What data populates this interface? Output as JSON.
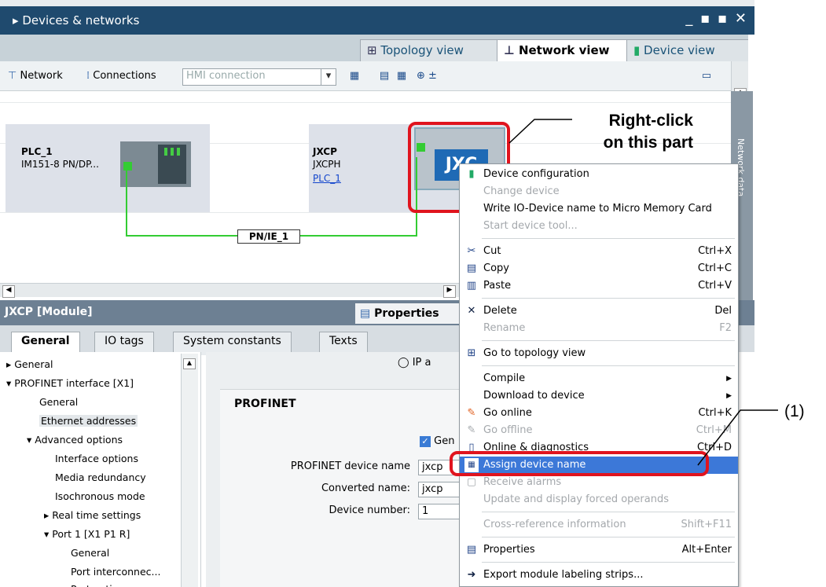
{
  "window": {
    "title": "Devices & networks",
    "controls": "_ ▪ ▪ ✕"
  },
  "view_tabs": [
    {
      "label": "Topology view"
    },
    {
      "label": "Network view"
    },
    {
      "label": "Device view"
    }
  ],
  "toolbar": {
    "network_label": "Network",
    "connections_label": "Connections",
    "connection_type": "HMI connection",
    "zoom_label": "⊕ ±"
  },
  "canvas": {
    "devices": [
      {
        "name": "PLC_1",
        "type": "IM151-8 PN/DP..."
      },
      {
        "name": "JXCP",
        "type": "JXCPH",
        "link": "PLC_1"
      }
    ],
    "network_label": "PN/IE_1",
    "jxcp_logo": "JXC"
  },
  "sidebar": {
    "label": "Network data"
  },
  "inspector": {
    "title": "JXCP [Module]",
    "properties_label": "Properties",
    "tabs": [
      "General",
      "IO tags",
      "System constants",
      "Texts"
    ]
  },
  "tree": {
    "items": [
      "General",
      "PROFINET interface [X1]",
      "General",
      "Ethernet addresses",
      "Advanced options",
      "Interface options",
      "Media redundancy",
      "Isochronous mode",
      "Real time settings",
      "Port 1 [X1 P1 R]",
      "General",
      "Port interconnec...",
      "Port options"
    ]
  },
  "form": {
    "ip_option": "IP a",
    "section_title": "PROFINET",
    "generate_check": "Gen",
    "fields": [
      {
        "label": "PROFINET device name",
        "value": "jxcp"
      },
      {
        "label": "Converted name:",
        "value": "jxcp"
      },
      {
        "label": "Device number:",
        "value": "1"
      }
    ]
  },
  "context_menu": {
    "items": [
      {
        "label": "Device configuration",
        "shortcut": ""
      },
      {
        "label": "Change device",
        "shortcut": ""
      },
      {
        "label": "Write IO-Device name to Micro Memory Card",
        "shortcut": ""
      },
      {
        "label": "Start device tool...",
        "shortcut": ""
      },
      {
        "label": "Cut",
        "shortcut": "Ctrl+X"
      },
      {
        "label": "Copy",
        "shortcut": "Ctrl+C"
      },
      {
        "label": "Paste",
        "shortcut": "Ctrl+V"
      },
      {
        "label": "Delete",
        "shortcut": "Del"
      },
      {
        "label": "Rename",
        "shortcut": "F2"
      },
      {
        "label": "Go to topology view",
        "shortcut": ""
      },
      {
        "label": "Compile",
        "shortcut": ""
      },
      {
        "label": "Download to device",
        "shortcut": ""
      },
      {
        "label": "Go online",
        "shortcut": "Ctrl+K"
      },
      {
        "label": "Go offline",
        "shortcut": "Ctrl+M"
      },
      {
        "label": "Online & diagnostics",
        "shortcut": "Ctrl+D"
      },
      {
        "label": "Assign device name",
        "shortcut": ""
      },
      {
        "label": "Receive alarms",
        "shortcut": ""
      },
      {
        "label": "Update and display forced operands",
        "shortcut": ""
      },
      {
        "label": "Cross-reference information",
        "shortcut": "Shift+F11"
      },
      {
        "label": "Properties",
        "shortcut": "Alt+Enter"
      },
      {
        "label": "Export module labeling strips...",
        "shortcut": ""
      }
    ]
  },
  "annotations": {
    "callout_line1": "Right-click",
    "callout_line2": "on this part",
    "marker": "(1)"
  },
  "colors": {
    "title_bar": "#1f4a6e",
    "highlight": "#3c78d8",
    "annotation_red": "#e0141e",
    "network_line": "#33cc33"
  }
}
